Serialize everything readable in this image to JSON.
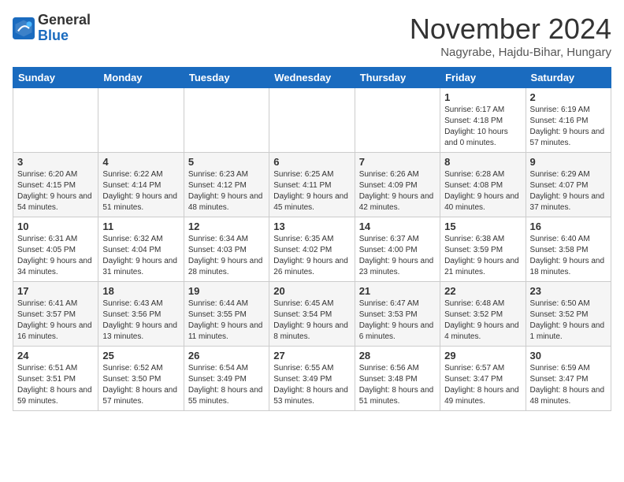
{
  "logo": {
    "general": "General",
    "blue": "Blue"
  },
  "header": {
    "month": "November 2024",
    "location": "Nagyrabe, Hajdu-Bihar, Hungary"
  },
  "weekdays": [
    "Sunday",
    "Monday",
    "Tuesday",
    "Wednesday",
    "Thursday",
    "Friday",
    "Saturday"
  ],
  "weeks": [
    [
      {
        "day": "",
        "info": ""
      },
      {
        "day": "",
        "info": ""
      },
      {
        "day": "",
        "info": ""
      },
      {
        "day": "",
        "info": ""
      },
      {
        "day": "",
        "info": ""
      },
      {
        "day": "1",
        "info": "Sunrise: 6:17 AM\nSunset: 4:18 PM\nDaylight: 10 hours and 0 minutes."
      },
      {
        "day": "2",
        "info": "Sunrise: 6:19 AM\nSunset: 4:16 PM\nDaylight: 9 hours and 57 minutes."
      }
    ],
    [
      {
        "day": "3",
        "info": "Sunrise: 6:20 AM\nSunset: 4:15 PM\nDaylight: 9 hours and 54 minutes."
      },
      {
        "day": "4",
        "info": "Sunrise: 6:22 AM\nSunset: 4:14 PM\nDaylight: 9 hours and 51 minutes."
      },
      {
        "day": "5",
        "info": "Sunrise: 6:23 AM\nSunset: 4:12 PM\nDaylight: 9 hours and 48 minutes."
      },
      {
        "day": "6",
        "info": "Sunrise: 6:25 AM\nSunset: 4:11 PM\nDaylight: 9 hours and 45 minutes."
      },
      {
        "day": "7",
        "info": "Sunrise: 6:26 AM\nSunset: 4:09 PM\nDaylight: 9 hours and 42 minutes."
      },
      {
        "day": "8",
        "info": "Sunrise: 6:28 AM\nSunset: 4:08 PM\nDaylight: 9 hours and 40 minutes."
      },
      {
        "day": "9",
        "info": "Sunrise: 6:29 AM\nSunset: 4:07 PM\nDaylight: 9 hours and 37 minutes."
      }
    ],
    [
      {
        "day": "10",
        "info": "Sunrise: 6:31 AM\nSunset: 4:05 PM\nDaylight: 9 hours and 34 minutes."
      },
      {
        "day": "11",
        "info": "Sunrise: 6:32 AM\nSunset: 4:04 PM\nDaylight: 9 hours and 31 minutes."
      },
      {
        "day": "12",
        "info": "Sunrise: 6:34 AM\nSunset: 4:03 PM\nDaylight: 9 hours and 28 minutes."
      },
      {
        "day": "13",
        "info": "Sunrise: 6:35 AM\nSunset: 4:02 PM\nDaylight: 9 hours and 26 minutes."
      },
      {
        "day": "14",
        "info": "Sunrise: 6:37 AM\nSunset: 4:00 PM\nDaylight: 9 hours and 23 minutes."
      },
      {
        "day": "15",
        "info": "Sunrise: 6:38 AM\nSunset: 3:59 PM\nDaylight: 9 hours and 21 minutes."
      },
      {
        "day": "16",
        "info": "Sunrise: 6:40 AM\nSunset: 3:58 PM\nDaylight: 9 hours and 18 minutes."
      }
    ],
    [
      {
        "day": "17",
        "info": "Sunrise: 6:41 AM\nSunset: 3:57 PM\nDaylight: 9 hours and 16 minutes."
      },
      {
        "day": "18",
        "info": "Sunrise: 6:43 AM\nSunset: 3:56 PM\nDaylight: 9 hours and 13 minutes."
      },
      {
        "day": "19",
        "info": "Sunrise: 6:44 AM\nSunset: 3:55 PM\nDaylight: 9 hours and 11 minutes."
      },
      {
        "day": "20",
        "info": "Sunrise: 6:45 AM\nSunset: 3:54 PM\nDaylight: 9 hours and 8 minutes."
      },
      {
        "day": "21",
        "info": "Sunrise: 6:47 AM\nSunset: 3:53 PM\nDaylight: 9 hours and 6 minutes."
      },
      {
        "day": "22",
        "info": "Sunrise: 6:48 AM\nSunset: 3:52 PM\nDaylight: 9 hours and 4 minutes."
      },
      {
        "day": "23",
        "info": "Sunrise: 6:50 AM\nSunset: 3:52 PM\nDaylight: 9 hours and 1 minute."
      }
    ],
    [
      {
        "day": "24",
        "info": "Sunrise: 6:51 AM\nSunset: 3:51 PM\nDaylight: 8 hours and 59 minutes."
      },
      {
        "day": "25",
        "info": "Sunrise: 6:52 AM\nSunset: 3:50 PM\nDaylight: 8 hours and 57 minutes."
      },
      {
        "day": "26",
        "info": "Sunrise: 6:54 AM\nSunset: 3:49 PM\nDaylight: 8 hours and 55 minutes."
      },
      {
        "day": "27",
        "info": "Sunrise: 6:55 AM\nSunset: 3:49 PM\nDaylight: 8 hours and 53 minutes."
      },
      {
        "day": "28",
        "info": "Sunrise: 6:56 AM\nSunset: 3:48 PM\nDaylight: 8 hours and 51 minutes."
      },
      {
        "day": "29",
        "info": "Sunrise: 6:57 AM\nSunset: 3:47 PM\nDaylight: 8 hours and 49 minutes."
      },
      {
        "day": "30",
        "info": "Sunrise: 6:59 AM\nSunset: 3:47 PM\nDaylight: 8 hours and 48 minutes."
      }
    ]
  ]
}
